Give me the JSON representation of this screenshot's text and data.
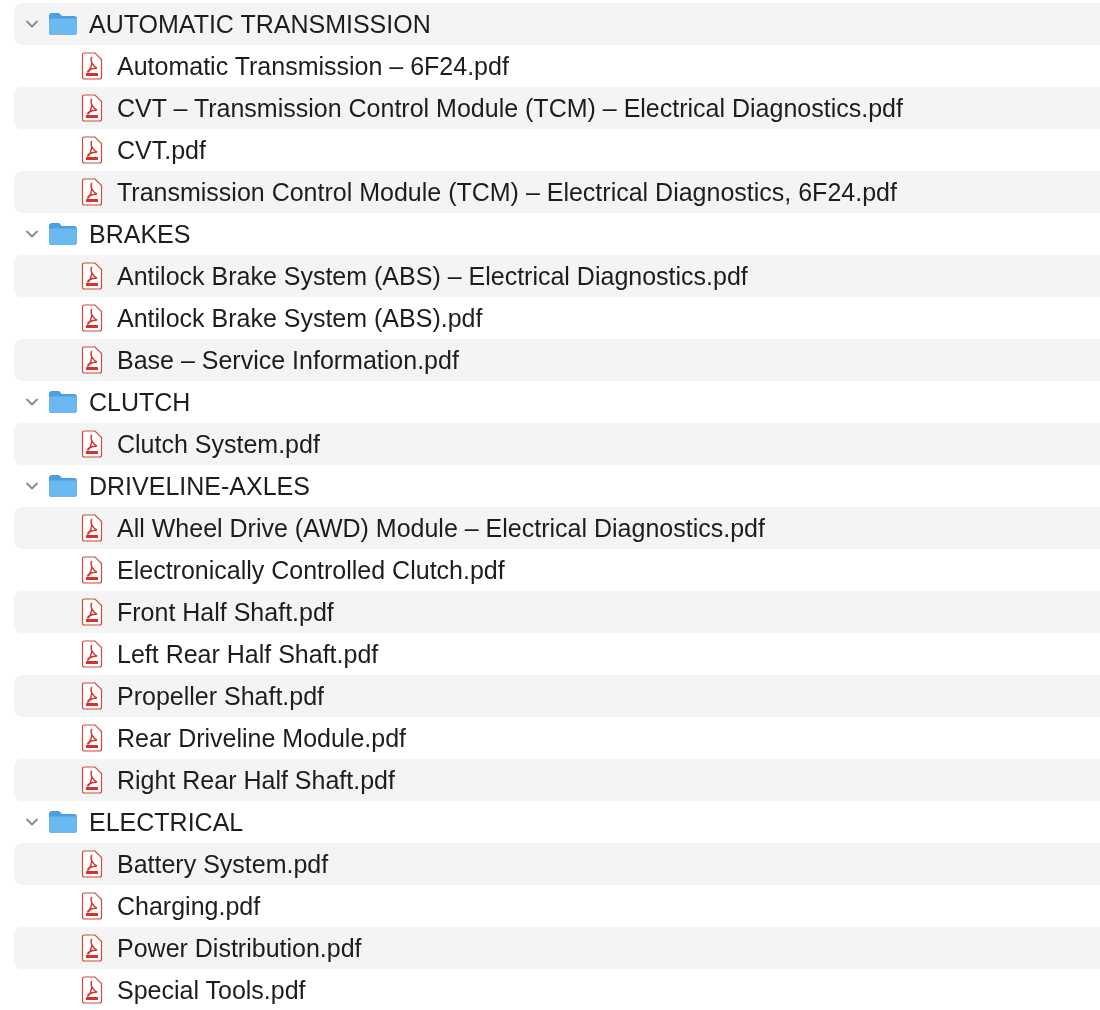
{
  "folders": [
    {
      "name": "AUTOMATIC TRANSMISSION",
      "expanded": true,
      "children": [
        {
          "name": "Automatic Transmission – 6F24.pdf"
        },
        {
          "name": "CVT – Transmission Control Module (TCM) – Electrical Diagnostics.pdf"
        },
        {
          "name": "CVT.pdf"
        },
        {
          "name": "Transmission Control Module (TCM) – Electrical Diagnostics, 6F24.pdf"
        }
      ]
    },
    {
      "name": "BRAKES",
      "expanded": true,
      "children": [
        {
          "name": "Antilock Brake System (ABS) – Electrical Diagnostics.pdf"
        },
        {
          "name": "Antilock Brake System (ABS).pdf"
        },
        {
          "name": "Base – Service Information.pdf"
        }
      ]
    },
    {
      "name": "CLUTCH",
      "expanded": true,
      "children": [
        {
          "name": "Clutch System.pdf"
        }
      ]
    },
    {
      "name": "DRIVELINE-AXLES",
      "expanded": true,
      "children": [
        {
          "name": "All Wheel Drive (AWD) Module – Electrical Diagnostics.pdf"
        },
        {
          "name": "Electronically Controlled Clutch.pdf"
        },
        {
          "name": "Front Half Shaft.pdf"
        },
        {
          "name": "Left Rear Half Shaft.pdf"
        },
        {
          "name": "Propeller Shaft.pdf"
        },
        {
          "name": "Rear Driveline Module.pdf"
        },
        {
          "name": "Right Rear Half Shaft.pdf"
        }
      ]
    },
    {
      "name": "ELECTRICAL",
      "expanded": true,
      "children": [
        {
          "name": "Battery System.pdf"
        },
        {
          "name": "Charging.pdf"
        },
        {
          "name": "Power Distribution.pdf"
        },
        {
          "name": "Special Tools.pdf"
        }
      ]
    }
  ]
}
